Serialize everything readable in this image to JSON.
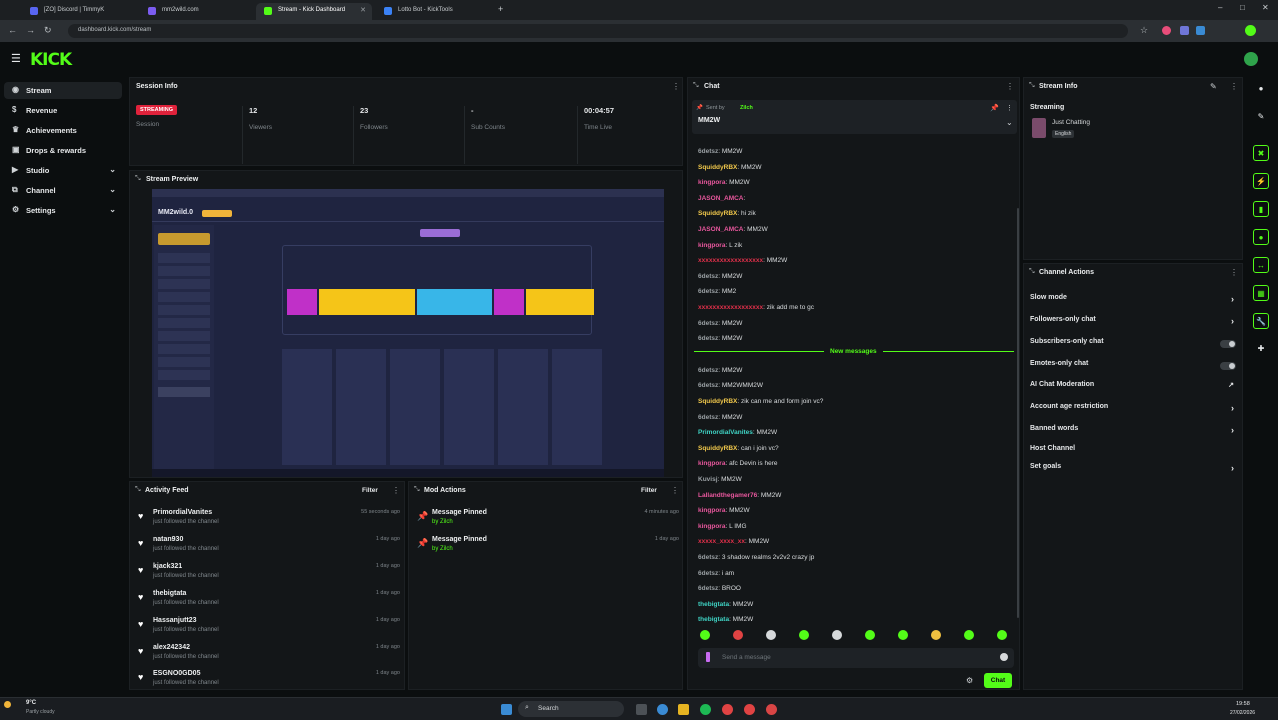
{
  "browser": {
    "tabs": [
      {
        "label": "[ZO] Discord | TimmyK",
        "active": false
      },
      {
        "label": "mm2wild.com",
        "active": false
      },
      {
        "label": "Stream - Kick Dashboard",
        "active": true
      },
      {
        "label": "Lotto Bot - KickTools",
        "active": false
      }
    ],
    "url": "dashboard.kick.com/stream"
  },
  "app": {
    "logo": "KICK"
  },
  "sidebar": {
    "items": [
      {
        "label": "Stream",
        "icon": "broadcast-icon",
        "active": true,
        "chevron": false
      },
      {
        "label": "Revenue",
        "icon": "dollar-icon",
        "active": false,
        "chevron": false
      },
      {
        "label": "Achievements",
        "icon": "trophy-icon",
        "active": false,
        "chevron": false
      },
      {
        "label": "Drops & rewards",
        "icon": "gift-icon",
        "active": false,
        "chevron": false
      },
      {
        "label": "Studio",
        "icon": "video-icon",
        "active": false,
        "chevron": true
      },
      {
        "label": "Channel",
        "icon": "channel-icon",
        "active": false,
        "chevron": true
      },
      {
        "label": "Settings",
        "icon": "gear-icon",
        "active": false,
        "chevron": true
      }
    ]
  },
  "session": {
    "title": "Session Info",
    "badge": "STREAMING",
    "stats": [
      {
        "value": "",
        "label": "Session"
      },
      {
        "value": "12",
        "label": "Viewers"
      },
      {
        "value": "23",
        "label": "Followers"
      },
      {
        "value": "-",
        "label": "Sub Counts"
      },
      {
        "value": "00:04:57",
        "label": "Time Live"
      }
    ]
  },
  "preview": {
    "title": "Stream Preview",
    "game_title": "MM2wild.0"
  },
  "activity": {
    "title": "Activity Feed",
    "filter": "Filter",
    "items": [
      {
        "name": "PrimordialVanites",
        "desc": "just followed the channel",
        "time": "55 seconds ago"
      },
      {
        "name": "natan930",
        "desc": "just followed the channel",
        "time": "1 day ago"
      },
      {
        "name": "kjack321",
        "desc": "just followed the channel",
        "time": "1 day ago"
      },
      {
        "name": "thebigtata",
        "desc": "just followed the channel",
        "time": "1 day ago"
      },
      {
        "name": "Hassanjutt23",
        "desc": "just followed the channel",
        "time": "1 day ago"
      },
      {
        "name": "alex242342",
        "desc": "just followed the channel",
        "time": "1 day ago"
      },
      {
        "name": "ESGNO0GD05",
        "desc": "just followed the channel",
        "time": "1 day ago"
      }
    ]
  },
  "mod": {
    "title": "Mod Actions",
    "filter": "Filter",
    "items": [
      {
        "name": "Message Pinned",
        "by": "by Zilch",
        "time": "4 minutes ago"
      },
      {
        "name": "Message Pinned",
        "by": "by Zilch",
        "time": "1 day ago"
      }
    ]
  },
  "chat": {
    "title": "Chat",
    "pinned_by": "Sent by",
    "pinned_user": "Zilch",
    "pinned_msg": "MM2W",
    "new_messages": "New messages",
    "placeholder": "Send a message",
    "send": "Chat",
    "messages": [
      {
        "user": "6detsz",
        "text": ": MM2W",
        "color": "#9aa0a4"
      },
      {
        "user": "SquiddyRBX",
        "text": ": MM2W",
        "color": "#f2c94c"
      },
      {
        "user": "kingpora",
        "text": ": MM2W",
        "color": "#e8579d"
      },
      {
        "user": "JASON_AMCA",
        "text": ": ",
        "color": "#e8579d"
      },
      {
        "user": "SquiddyRBX",
        "text": ": hi zik",
        "color": "#f2c94c"
      },
      {
        "user": "JASON_AMCA",
        "text": ": MM2W",
        "color": "#e8579d"
      },
      {
        "user": "kingpora",
        "text": ": L zik",
        "color": "#e8579d"
      },
      {
        "user": "xxxxxxxxxxxxxxxxxx",
        "text": ": MM2W",
        "color": "#e0304a"
      },
      {
        "user": "6detsz",
        "text": ": MM2W",
        "color": "#9aa0a4"
      },
      {
        "user": "6detsz",
        "text": ": MM2",
        "color": "#9aa0a4"
      },
      {
        "user": "xxxxxxxxxxxxxxxxxx",
        "text": ": zik add me to gc",
        "color": "#e0304a"
      },
      {
        "user": "6detsz",
        "text": ": MM2W",
        "color": "#9aa0a4"
      },
      {
        "user": "6detsz",
        "text": ": MM2W",
        "color": "#9aa0a4"
      },
      {
        "user": "6detsz",
        "text": ": MM2W",
        "color": "#9aa0a4"
      },
      {
        "user": "6detsz",
        "text": ": MM2WMM2W",
        "color": "#9aa0a4"
      },
      {
        "user": "SquiddyRBX",
        "text": ": zik can me and form join vc?",
        "color": "#f2c94c"
      },
      {
        "user": "6detsz",
        "text": ": MM2W",
        "color": "#9aa0a4"
      },
      {
        "user": "PrimordialVanites",
        "text": ": MM2W",
        "color": "#3fd3c4"
      },
      {
        "user": "SquiddyRBX",
        "text": ": can i join vc?",
        "color": "#f2c94c"
      },
      {
        "user": "kingpora",
        "text": ": afc Devin is here",
        "color": "#e8579d"
      },
      {
        "user": "Kuvisj",
        "text": ": MM2W",
        "color": "#9aa0a4"
      },
      {
        "user": "Lallandthegamer76",
        "text": ": MM2W",
        "color": "#e8579d"
      },
      {
        "user": "kingpora",
        "text": ": MM2W",
        "color": "#e8579d"
      },
      {
        "user": "kingpora",
        "text": ": L IMG",
        "color": "#e8579d"
      },
      {
        "user": "xxxxx_xxxx_xx",
        "text": ": MM2W",
        "color": "#e0304a"
      },
      {
        "user": "6detsz",
        "text": ": 3 shadow realms 2v2v2 crazy jp",
        "color": "#9aa0a4"
      },
      {
        "user": "6detsz",
        "text": ": i am",
        "color": "#9aa0a4"
      },
      {
        "user": "6detsz",
        "text": ": BROO",
        "color": "#9aa0a4"
      },
      {
        "user": "thebigtata",
        "text": ": MM2W",
        "color": "#3fd3c4"
      },
      {
        "user": "thebigtata",
        "text": ": MM2W",
        "color": "#3fd3c4"
      }
    ]
  },
  "stream_info": {
    "title": "Stream Info",
    "status": "Streaming",
    "category": "Just Chatting",
    "language": "English"
  },
  "channel_actions": {
    "title": "Channel Actions",
    "items": [
      {
        "label": "Slow mode",
        "control": "chevron"
      },
      {
        "label": "Followers-only chat",
        "control": "chevron"
      },
      {
        "label": "Subscribers-only chat",
        "control": "toggle"
      },
      {
        "label": "Emotes-only chat",
        "control": "toggle"
      },
      {
        "label": "AI Chat Moderation",
        "control": "external"
      },
      {
        "label": "Account age restriction",
        "control": "chevron"
      },
      {
        "label": "Banned words",
        "control": "chevron"
      },
      {
        "label": "Host Channel",
        "control": "none"
      },
      {
        "label": "Set goals",
        "control": "chevron"
      }
    ]
  },
  "taskbar": {
    "weather_temp": "9°C",
    "weather_desc": "Partly cloudy",
    "search": "Search",
    "time": "19:58",
    "date": "27/02/2026"
  },
  "colors": {
    "accent": "#53fc18",
    "badge": "#e0223b",
    "panel": "#131618"
  }
}
